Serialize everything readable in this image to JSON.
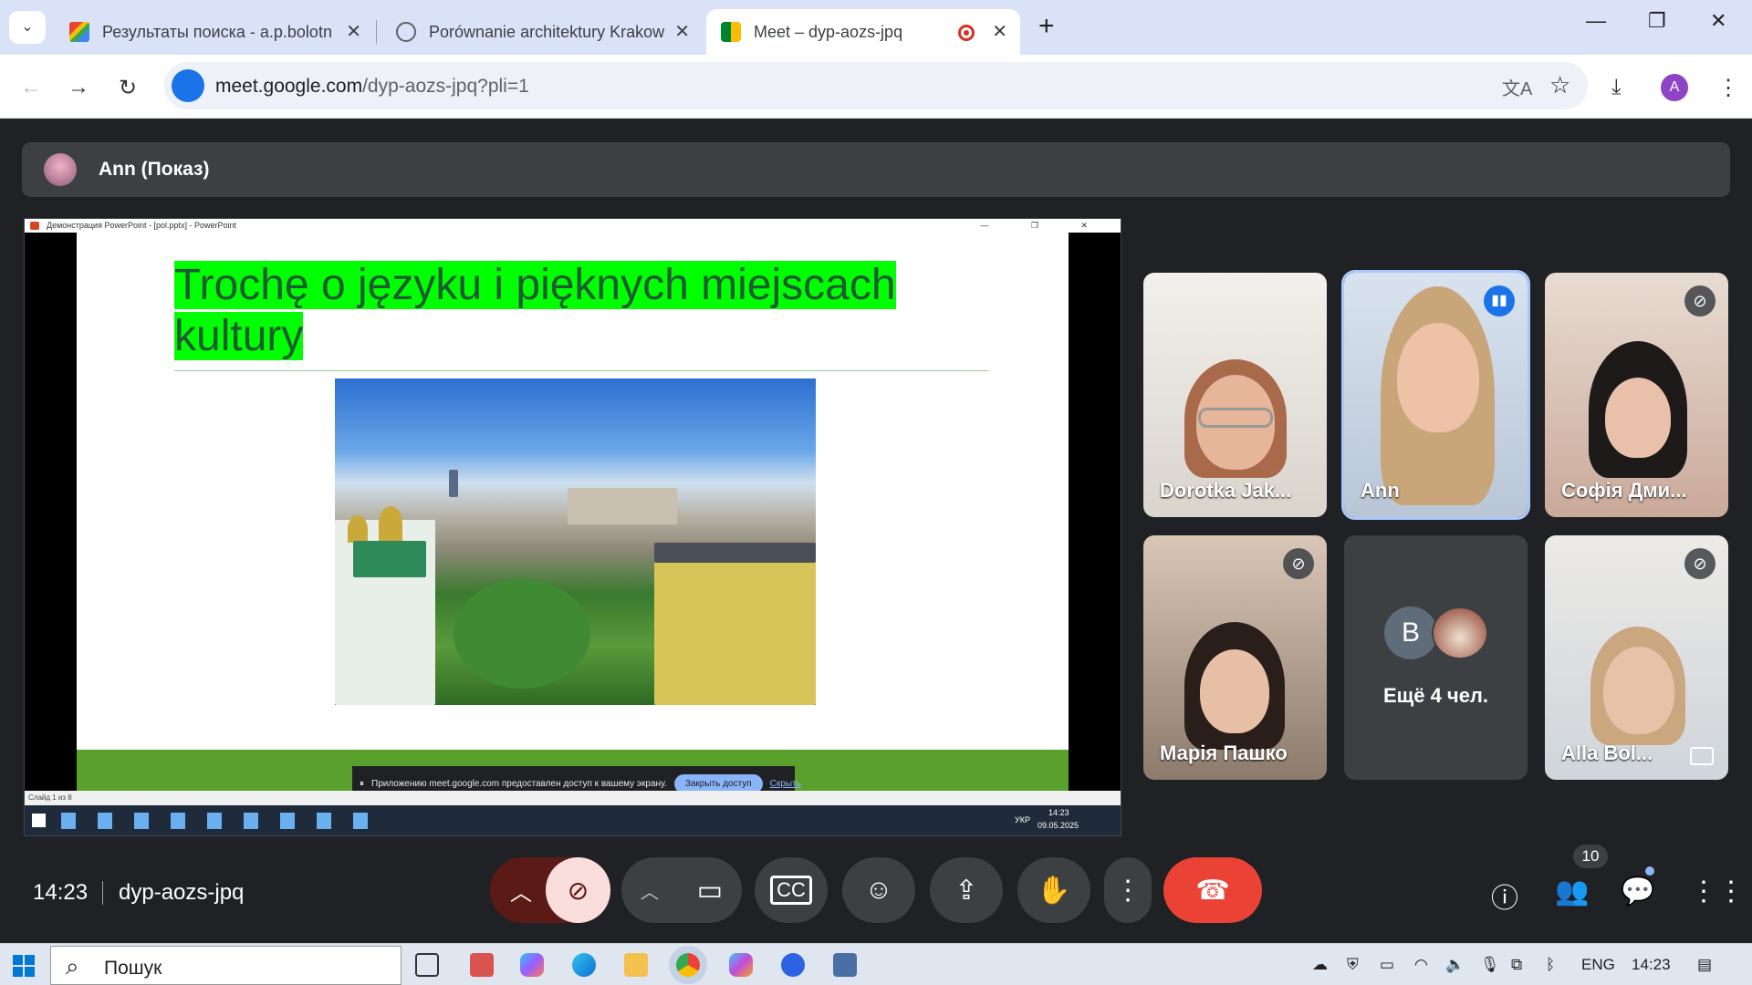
{
  "browser": {
    "tabs": [
      {
        "title": "Результаты поиска - a.p.bolotn",
        "favicon": "gmail-icon"
      },
      {
        "title": "Porównanie architektury Krakow",
        "favicon": "globe-icon"
      },
      {
        "title": "Meet – dyp-aozs-jpq",
        "favicon": "meet-icon",
        "recording": true
      }
    ],
    "new_tab": "+",
    "url_host": "meet.google.com",
    "url_path": "/dyp-aozs-jpq?pli=1",
    "profile_initial": "A"
  },
  "presenter_bar": {
    "name": "Ann (Показ)"
  },
  "shared_screen": {
    "ppt_title": "Демонстрация PowerPoint - [pol.pptx] - PowerPoint",
    "slide_title": "Trochę o języku i pięknych miejscach kultury",
    "slide_status": "Слайд 1 из 8",
    "win_clock_time": "14:23",
    "win_clock_date": "09.05.2025",
    "win_lang": "УКР",
    "notice_text": "Приложению meet.google.com предоставлен доступ к вашему экрану.",
    "notice_stop": "Закрыть доступ",
    "notice_hide": "Скрыть"
  },
  "participants": [
    {
      "name": "Dorotka Jak...",
      "muted": false
    },
    {
      "name": "Ann",
      "muted": false,
      "speaking": true
    },
    {
      "name": "Софія Дми...",
      "muted": true
    },
    {
      "name": "Марія Пашко",
      "muted": true
    },
    {
      "name": "Ещё 4 чел.",
      "initial": "B"
    },
    {
      "name": "Alla Bol...",
      "muted": true
    }
  ],
  "meeting": {
    "time": "14:23",
    "code": "dyp-aozs-jpq",
    "participant_count": "10"
  },
  "taskbar": {
    "search_label": "Пошук",
    "lang": "ENG",
    "time": "14:23"
  },
  "colors": {
    "accent": "#8ab4f8",
    "end_call": "#ea4335",
    "slide_highlight": "#00ff00"
  }
}
